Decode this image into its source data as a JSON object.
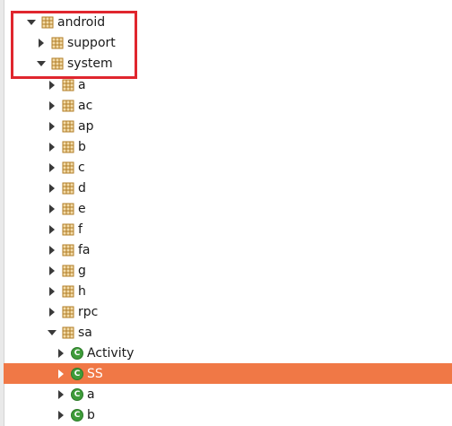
{
  "tree": {
    "nodes": [
      {
        "label": "android",
        "kind": "package",
        "state": "expanded"
      },
      {
        "label": "support",
        "kind": "package",
        "state": "collapsed"
      },
      {
        "label": "system",
        "kind": "package",
        "state": "expanded"
      },
      {
        "label": "a",
        "kind": "package",
        "state": "collapsed"
      },
      {
        "label": "ac",
        "kind": "package",
        "state": "collapsed"
      },
      {
        "label": "ap",
        "kind": "package",
        "state": "collapsed"
      },
      {
        "label": "b",
        "kind": "package",
        "state": "collapsed"
      },
      {
        "label": "c",
        "kind": "package",
        "state": "collapsed"
      },
      {
        "label": "d",
        "kind": "package",
        "state": "collapsed"
      },
      {
        "label": "e",
        "kind": "package",
        "state": "collapsed"
      },
      {
        "label": "f",
        "kind": "package",
        "state": "collapsed"
      },
      {
        "label": "fa",
        "kind": "package",
        "state": "collapsed"
      },
      {
        "label": "g",
        "kind": "package",
        "state": "collapsed"
      },
      {
        "label": "h",
        "kind": "package",
        "state": "collapsed"
      },
      {
        "label": "rpc",
        "kind": "package",
        "state": "collapsed"
      },
      {
        "label": "sa",
        "kind": "package",
        "state": "expanded"
      },
      {
        "label": "Activity",
        "kind": "class",
        "state": "collapsed"
      },
      {
        "label": "SS",
        "kind": "class",
        "state": "collapsed",
        "selected": true
      },
      {
        "label": "a",
        "kind": "class",
        "state": "collapsed"
      },
      {
        "label": "b",
        "kind": "class",
        "state": "collapsed"
      }
    ]
  },
  "class_icon_letter": "C",
  "colors": {
    "selection": "#f07846",
    "highlight_box": "#e0262e",
    "package_icon": "#c9922f",
    "class_icon": "#3f9c3a"
  }
}
